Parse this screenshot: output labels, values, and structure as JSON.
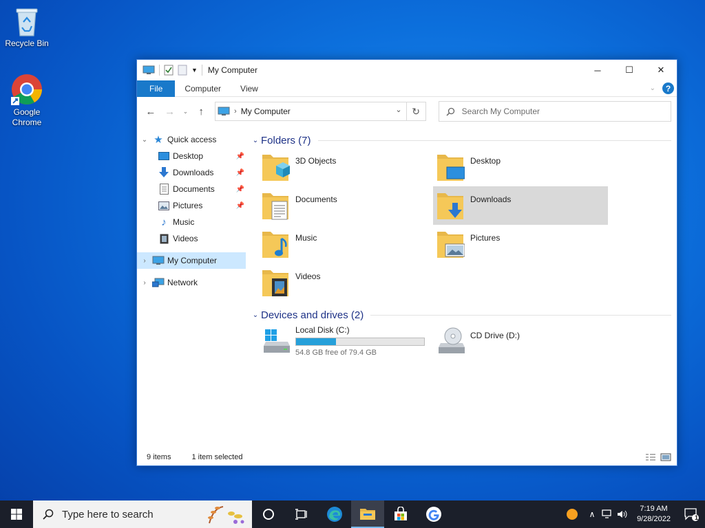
{
  "desktop": {
    "icons": [
      {
        "label": "Recycle Bin"
      },
      {
        "label": "Google Chrome"
      }
    ]
  },
  "window": {
    "title": "My Computer",
    "controls": {
      "minimize": "─",
      "maximize": "☐",
      "close": "✕"
    },
    "ribbon": {
      "tabs": [
        "File",
        "Computer",
        "View"
      ]
    },
    "address": {
      "path": "My Computer"
    },
    "search": {
      "placeholder": "Search My Computer"
    },
    "nav": {
      "quick_access": "Quick access",
      "quick_items": [
        "Desktop",
        "Downloads",
        "Documents",
        "Pictures",
        "Music",
        "Videos"
      ],
      "my_computer": "My Computer",
      "network": "Network"
    },
    "folders_header": "Folders (7)",
    "folders": [
      "3D Objects",
      "Desktop",
      "Documents",
      "Downloads",
      "Music",
      "Pictures",
      "Videos"
    ],
    "selected_folder": "Downloads",
    "drives_header": "Devices and drives (2)",
    "drives": [
      {
        "name": "Local Disk (C:)",
        "free": "54.8 GB free of 79.4 GB",
        "used_fraction": 0.31
      },
      {
        "name": "CD Drive (D:)"
      }
    ],
    "status": {
      "items": "9 items",
      "selected": "1 item selected"
    }
  },
  "taskbar": {
    "search_placeholder": "Type here to search",
    "time": "7:19 AM",
    "date": "9/28/2022",
    "notification_count": "1"
  },
  "colors": {
    "accent": "#1979ca",
    "selection": "#cce8ff",
    "drive_bar": "#26a0da",
    "folder": "#f5c858"
  }
}
